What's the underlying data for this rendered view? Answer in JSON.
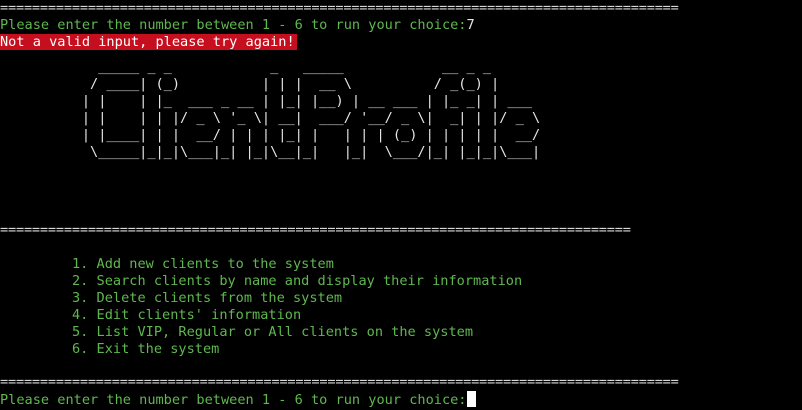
{
  "terminal": {
    "separator_top": "=====================================================================================",
    "prompt_label": "Please enter the number between 1 - 6 to run your choice:",
    "previous_input": "7",
    "error_message": "Not a valid input, please try again!",
    "banner_art": "            _____ _ _            _   _____            __ _ _      \n           / ____| (_)          | | |  __ \\          / _(_) |     \n          | |    | |_  ___ _ __ | |_| |__) | __ ___ | |_ _| | ___ \n          | |    | | |/ _ \\ '_ \\| __|  ___/ '__/ _ \\|  _| | |/ _ \\\n          | |____| | |  __/ | | | |_| |   | | | (_) | | | | |  __/\n           \\_____|_|_|\\___|_| |_|\\__|_|   |_|  \\___/|_| |_|_|\\___|",
    "banner_text": "ClientProfile",
    "separator_middle": "===============================================================================",
    "separator_bottom": "=====================================================================================",
    "menu_items": [
      "1. Add new clients to the system",
      "2. Search clients by name and display their information",
      "3. Delete clients from the system",
      "4. Edit clients' information",
      "5. List VIP, Regular or All clients on the system",
      "6. Exit the system"
    ],
    "prompt_bottom": "Please enter the number between 1 - 6 to run your choice:",
    "colors": {
      "background": "#000000",
      "prompt_text": "#5fb84f",
      "error_background": "#c50f1f",
      "error_text": "#ffffff",
      "separator": "#d8d8d8"
    }
  }
}
